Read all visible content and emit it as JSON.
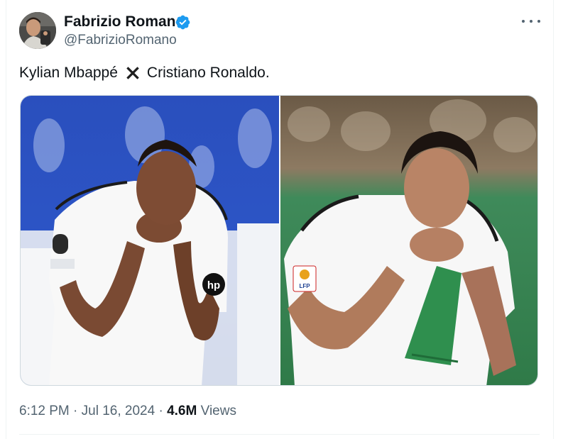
{
  "author": {
    "name": "Fabrizio Romano",
    "handle": "@FabrizioRomano",
    "verified_color": "#1d9bf0"
  },
  "more_icon": "more-horizontal-icon",
  "tweet": {
    "text_before": "Kylian Mbappé",
    "emoji": "cross-mark-emoji",
    "text_after": "Cristiano Ronaldo."
  },
  "media": {
    "images": [
      {
        "name": "mbappe-kissing-badge-photo"
      },
      {
        "name": "ronaldo-kissing-badge-photo"
      }
    ]
  },
  "meta": {
    "time": "6:12 PM",
    "separator": "·",
    "date": "Jul 16, 2024",
    "separator2": "·",
    "views_count": "4.6M",
    "views_label": "Views"
  },
  "colors": {
    "text": "#0f1419",
    "secondary": "#536471",
    "verified": "#1d9bf0",
    "border": "#cfd9de"
  }
}
